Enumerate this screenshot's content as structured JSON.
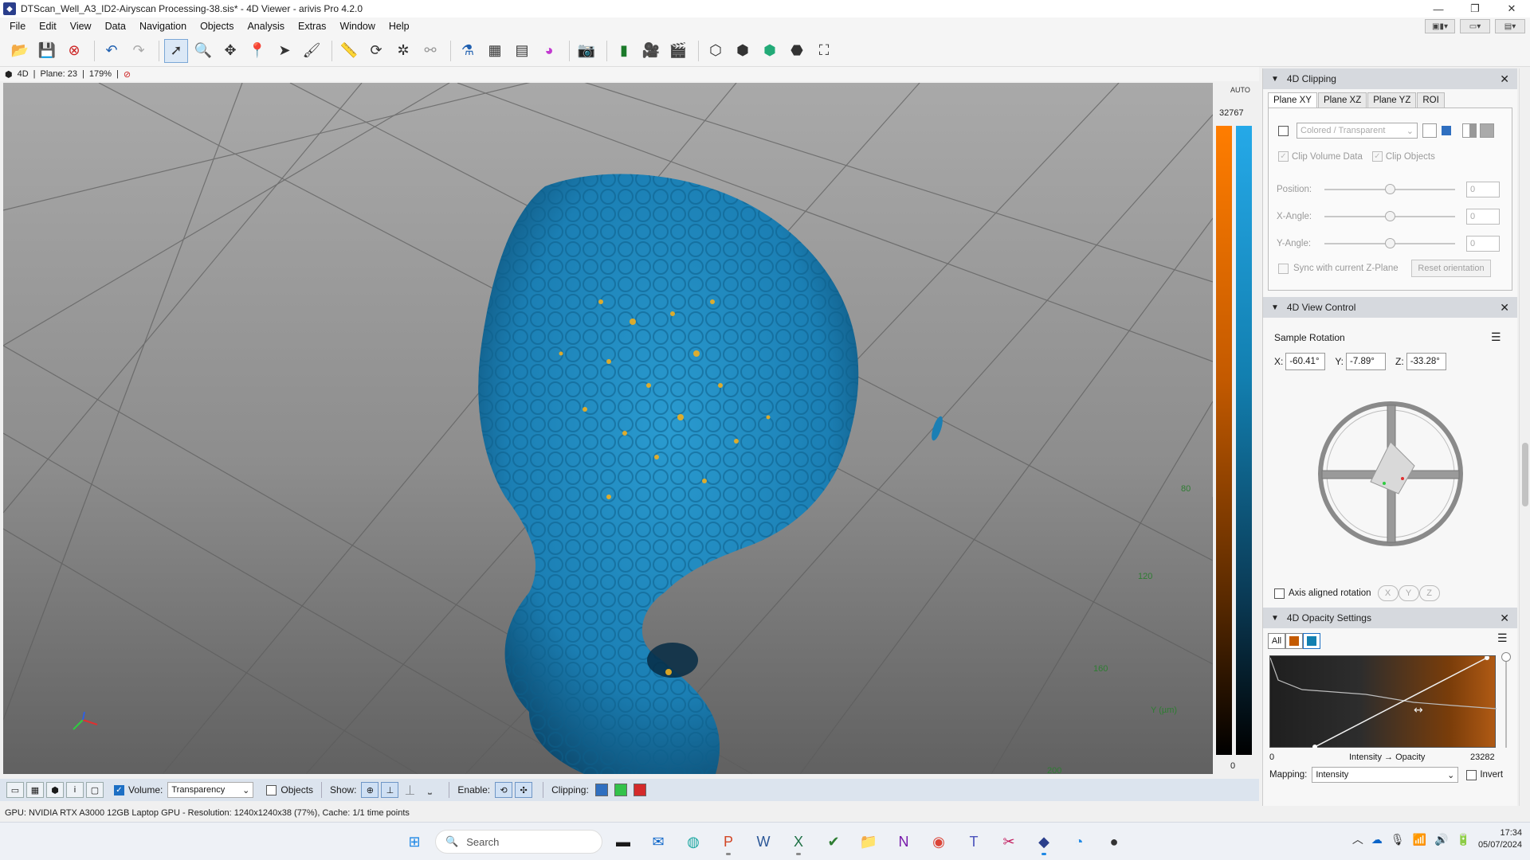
{
  "window": {
    "title": "DTScan_Well_A3_ID2-Airyscan Processing-38.sis* - 4D Viewer - arivis Pro 4.2.0",
    "controls": [
      "—",
      "❐",
      "✕"
    ]
  },
  "menu": [
    "File",
    "Edit",
    "View",
    "Data",
    "Navigation",
    "Objects",
    "Analysis",
    "Extras",
    "Window",
    "Help"
  ],
  "viewer_info": {
    "mode": "4D",
    "plane": "Plane: 23",
    "zoom": "179%"
  },
  "axis": {
    "ticks": [
      "80",
      "120",
      "160",
      "200"
    ],
    "name": "Y (µm)"
  },
  "colorbar": {
    "auto": "AUTO",
    "max": "32767",
    "min": "0",
    "orange": "#ff7d00",
    "blue": "#25a9e8"
  },
  "viewerbar": {
    "volume_label": "Volume:",
    "volume_mode": "Transparency",
    "objects_label": "Objects",
    "show_label": "Show:",
    "enable_label": "Enable:",
    "clipping_label": "Clipping:",
    "clip_colors": [
      "#2f6fc0",
      "#33c24a",
      "#d42a2a"
    ]
  },
  "status": "GPU: NVIDIA RTX A3000 12GB Laptop GPU  - Resolution: 1240x1240x38 (77%), Cache: 1/1 time points",
  "clipping_panel": {
    "title": "4D Clipping",
    "tabs": [
      "Plane XY",
      "Plane XZ",
      "Plane YZ",
      "ROI"
    ],
    "mode": "Colored / Transparent",
    "clip_volume": "Clip Volume Data",
    "clip_objects": "Clip Objects",
    "position_label": "Position:",
    "position_val": "0",
    "xangle_label": "X-Angle:",
    "xangle_val": "0",
    "yangle_label": "Y-Angle:",
    "yangle_val": "0",
    "sync_label": "Sync with current Z-Plane",
    "reset_label": "Reset orientation"
  },
  "view_control": {
    "title": "4D View Control",
    "sample_rotation": "Sample Rotation",
    "x_label": "X:",
    "x_val": "-60.41°",
    "y_label": "Y:",
    "y_val": "-7.89°",
    "z_label": "Z:",
    "z_val": "-33.28°",
    "axis_aligned": "Axis aligned rotation",
    "axes": [
      "X",
      "Y",
      "Z"
    ]
  },
  "opacity": {
    "title": "4D Opacity Settings",
    "all_label": "All",
    "min": "0",
    "caption": "Intensity → Opacity",
    "max": "23282",
    "mapping_label": "Mapping:",
    "mapping_val": "Intensity",
    "invert_label": "Invert"
  },
  "taskbar": {
    "search": "Search",
    "time": "17:34",
    "date": "05/07/2024"
  }
}
